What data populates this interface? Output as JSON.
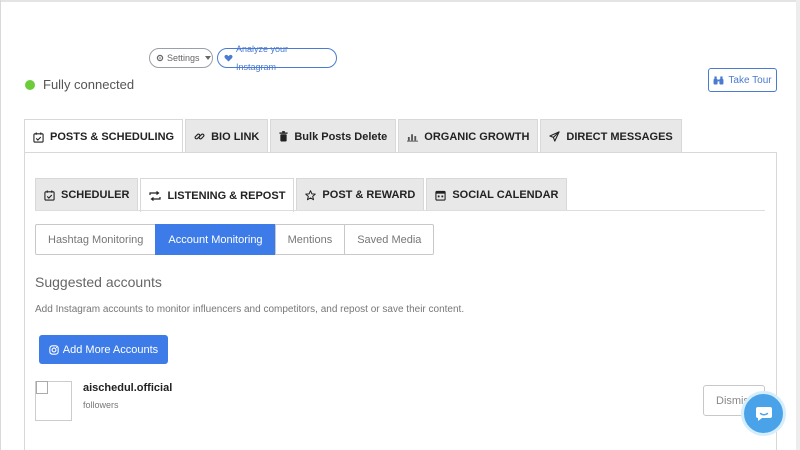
{
  "header": {
    "settings_label": "Settings",
    "analyze_label": "Analyze your Instagram",
    "status_text": "Fully connected",
    "take_tour_label": "Take Tour"
  },
  "main_tabs": [
    {
      "label": "POSTS & SCHEDULING",
      "icon": "calendar-check-icon",
      "active": true
    },
    {
      "label": "BIO LINK",
      "icon": "link-icon",
      "active": false
    },
    {
      "label": "Bulk Posts Delete",
      "icon": "trash-icon",
      "active": false
    },
    {
      "label": "ORGANIC GROWTH",
      "icon": "bar-chart-icon",
      "active": false
    },
    {
      "label": "DIRECT MESSAGES",
      "icon": "paper-plane-icon",
      "active": false
    }
  ],
  "sub_tabs": [
    {
      "label": "SCHEDULER",
      "icon": "calendar-check-icon",
      "active": false
    },
    {
      "label": "LISTENING & REPOST",
      "icon": "repost-icon",
      "active": true
    },
    {
      "label": "POST & REWARD",
      "icon": "star-icon",
      "active": false
    },
    {
      "label": "SOCIAL CALENDAR",
      "icon": "calendar-icon",
      "active": false
    }
  ],
  "monitor_tabs": [
    {
      "label": "Hashtag Monitoring",
      "active": false
    },
    {
      "label": "Account Monitoring",
      "active": true
    },
    {
      "label": "Mentions",
      "active": false
    },
    {
      "label": "Saved Media",
      "active": false
    }
  ],
  "suggested": {
    "title": "Suggested accounts",
    "description": "Add Instagram accounts to monitor influencers and competitors, and repost or save their content.",
    "add_button_label": "Add More Accounts"
  },
  "accounts": [
    {
      "name": "aischedul.official",
      "followers_text": "followers",
      "dismiss_label": "Dismiss"
    }
  ],
  "colors": {
    "accent": "#3d7be8",
    "status_dot": "#6ccc3a",
    "chat_fab": "#4aa3e8"
  }
}
